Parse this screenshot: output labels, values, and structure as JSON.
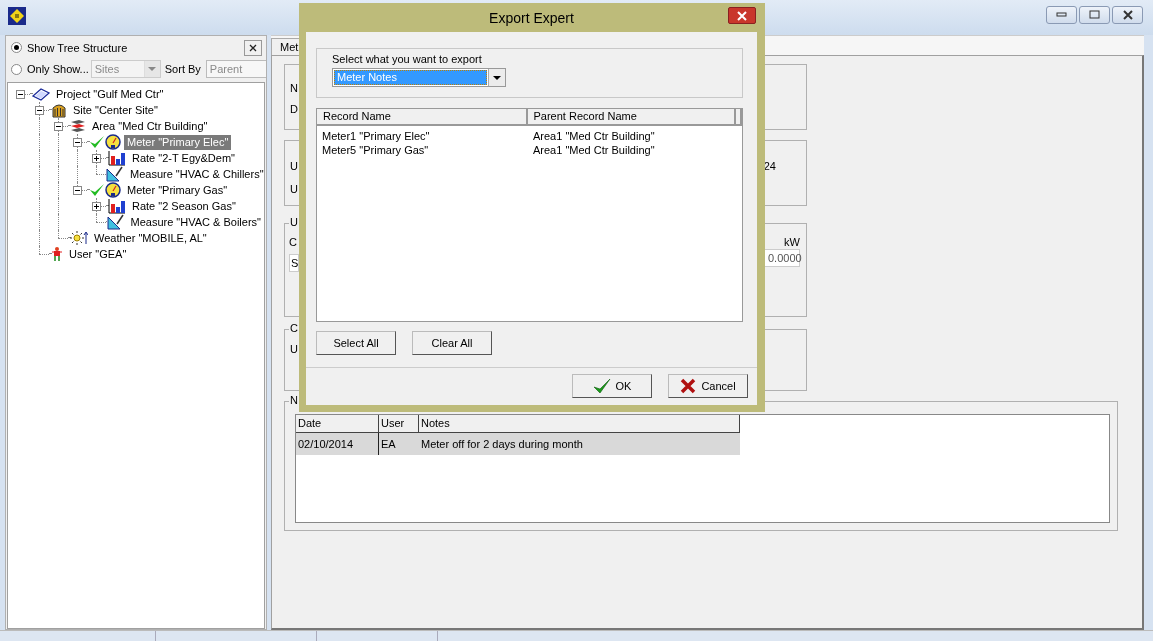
{
  "tree_panel": {
    "options": [
      {
        "label": "Show Tree Structure",
        "selected": true
      },
      {
        "label": "Only Show...",
        "selected": false
      }
    ],
    "filter_combo": {
      "value": "Sites",
      "disabled": true
    },
    "sort_by_label": "Sort By",
    "sort_field": {
      "placeholder": "Parent"
    },
    "tree": [
      {
        "kind": "project",
        "label": "Project \"Gulf Med Ctr\"",
        "expanded": true,
        "checked": false,
        "selected": false,
        "children": [
          {
            "kind": "site",
            "label": "Site \"Center Site\"",
            "expanded": true,
            "checked": false,
            "selected": false,
            "children": [
              {
                "kind": "area",
                "label": "Area \"Med Ctr Building\"",
                "expanded": true,
                "checked": false,
                "selected": false,
                "children": [
                  {
                    "kind": "meter",
                    "label": "Meter \"Primary Elec\"",
                    "expanded": true,
                    "checked": true,
                    "selected": true,
                    "children": [
                      {
                        "kind": "rate",
                        "label": "Rate \"2-T Egy&Dem\"",
                        "expanded": false,
                        "checked": false,
                        "selected": false
                      },
                      {
                        "kind": "measure",
                        "label": "Measure \"HVAC & Chillers\"",
                        "checked": false,
                        "selected": false
                      }
                    ]
                  },
                  {
                    "kind": "meter",
                    "label": "Meter \"Primary Gas\"",
                    "expanded": true,
                    "checked": true,
                    "selected": false,
                    "children": [
                      {
                        "kind": "rate",
                        "label": "Rate \"2 Season Gas\"",
                        "expanded": false,
                        "checked": false,
                        "selected": false
                      },
                      {
                        "kind": "measure",
                        "label": "Measure \"HVAC & Boilers\"",
                        "checked": false,
                        "selected": false
                      }
                    ]
                  }
                ]
              },
              {
                "kind": "weather",
                "label": "Weather \"MOBILE, AL\"",
                "checked": false,
                "selected": false
              }
            ]
          },
          {
            "kind": "user",
            "label": "User \"GEA\"",
            "checked": false,
            "selected": false
          }
        ]
      }
    ]
  },
  "detail_panel": {
    "tab": {
      "label": "Met",
      "selected": true
    },
    "group_1": {
      "labels": [
        "N",
        "D"
      ]
    },
    "group_2": {
      "labels": [
        "U",
        "U"
      ],
      "value": "24"
    },
    "group_3": {
      "legend": "U",
      "label": "C",
      "field": "S",
      "unit_label": "kW",
      "unit_field": "0.0000"
    },
    "group_4": {
      "legend": "C",
      "label": "U"
    },
    "notes_group": {
      "legend": "N",
      "columns": [
        "Date",
        "User",
        "Notes"
      ],
      "rows": [
        {
          "cells": [
            "02/10/2014",
            "EA",
            "Meter off for 2 days during month"
          ],
          "selected": true
        }
      ]
    }
  },
  "dialog": {
    "title": "Export Expert",
    "export_group": {
      "label": "Select what you want to export",
      "combo": {
        "value": "Meter Notes"
      }
    },
    "records": {
      "columns": [
        "Record Name",
        "Parent Record Name"
      ],
      "rows": [
        {
          "cells": [
            "Meter1 \"Primary Elec\"",
            "Area1 \"Med Ctr Building\""
          ]
        },
        {
          "cells": [
            "Meter5 \"Primary Gas\"",
            "Area1 \"Med Ctr Building\""
          ]
        }
      ]
    },
    "buttons": [
      {
        "label": "Select All"
      },
      {
        "label": "Clear All"
      }
    ],
    "footer_buttons": [
      {
        "label": "OK",
        "kind": "ok"
      },
      {
        "label": "Cancel",
        "kind": "cancel"
      }
    ]
  }
}
